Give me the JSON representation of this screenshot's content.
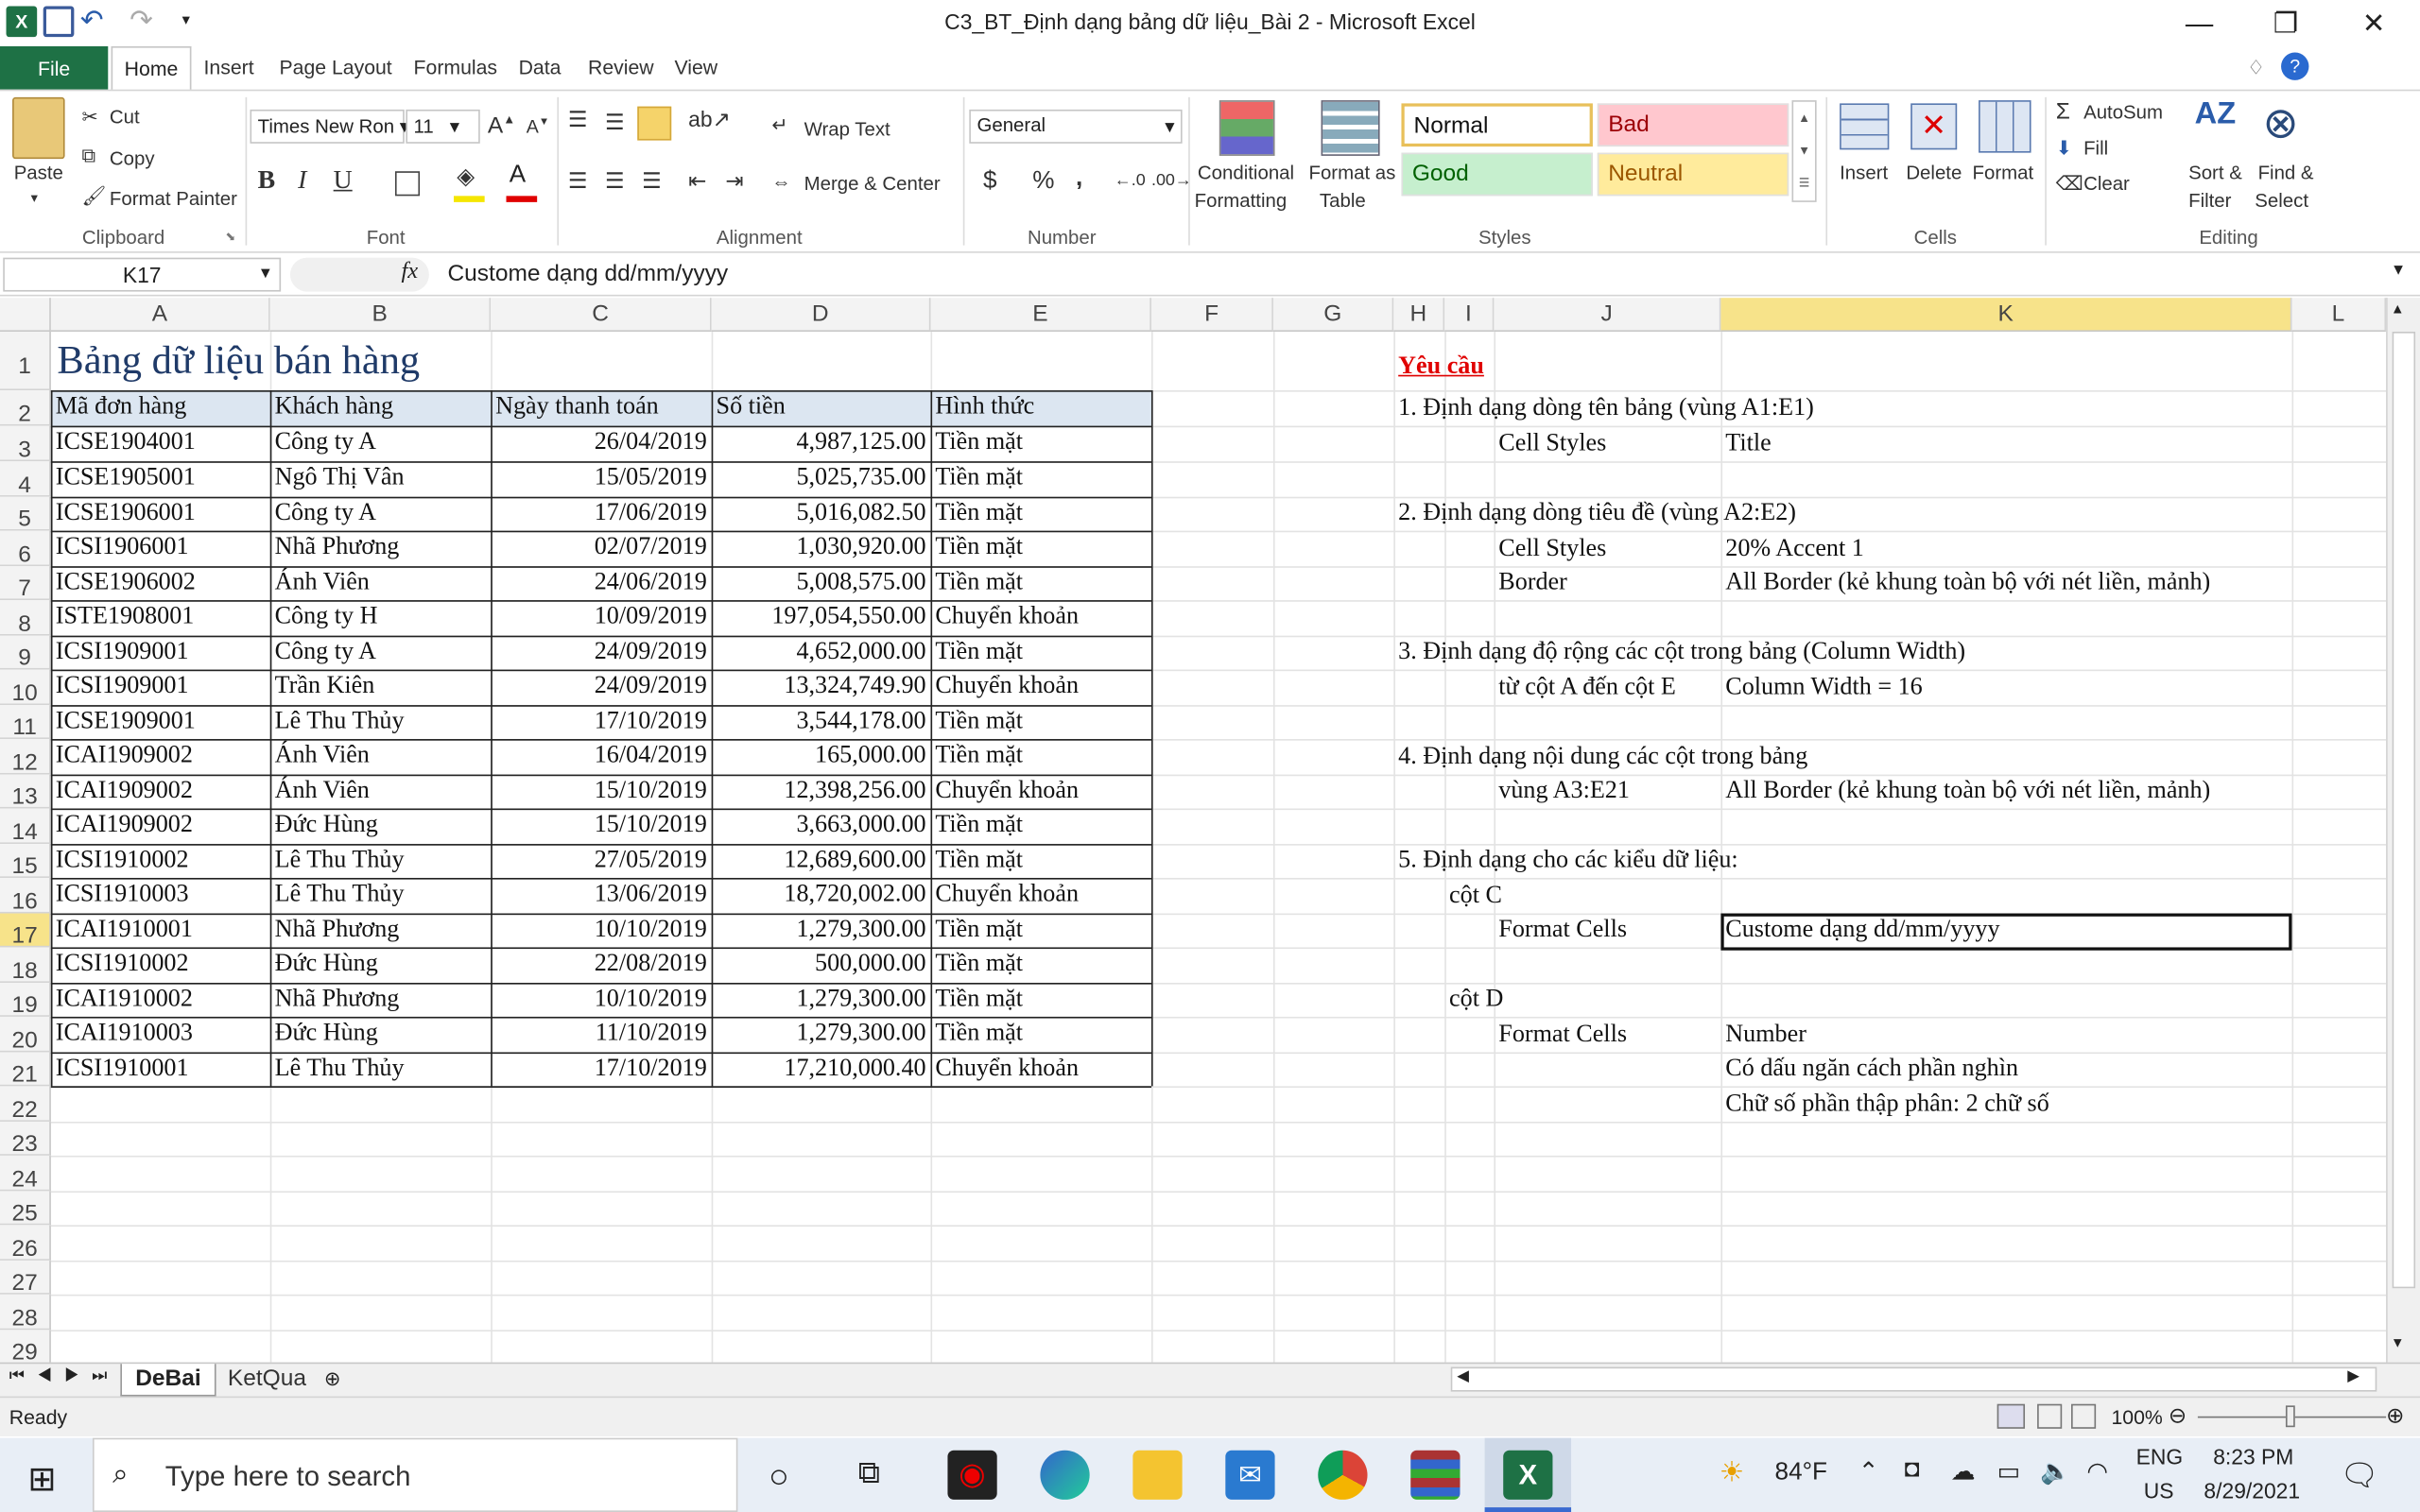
{
  "window": {
    "title": "C3_BT_Định dạng bảng dữ liệu_Bài 2  -  Microsoft Excel",
    "minimize": "—",
    "restore": "❐",
    "close": "✕"
  },
  "tabs": [
    "File",
    "Home",
    "Insert",
    "Page Layout",
    "Formulas",
    "Data",
    "Review",
    "View"
  ],
  "ribbon": {
    "clipboard": {
      "paste": "Paste",
      "cut": "Cut",
      "copy": "Copy",
      "format_painter": "Format Painter",
      "label": "Clipboard"
    },
    "font": {
      "name": "Times New Ron",
      "size": "11",
      "bold": "B",
      "italic": "I",
      "underline": "U",
      "label": "Font"
    },
    "alignment": {
      "wrap": "Wrap Text",
      "merge": "Merge & Center",
      "label": "Alignment"
    },
    "number": {
      "format": "General",
      "currency": "$",
      "percent": "%",
      "comma": ",",
      "label": "Number"
    },
    "styles": {
      "conditional": "Conditional",
      "conditional2": "Formatting",
      "format_table": "Format as",
      "format_table2": "Table",
      "normal": "Normal",
      "bad": "Bad",
      "good": "Good",
      "neutral": "Neutral",
      "label": "Styles"
    },
    "cells": {
      "insert": "Insert",
      "delete": "Delete",
      "format": "Format",
      "label": "Cells"
    },
    "editing": {
      "autosum": "AutoSum",
      "fill": "Fill",
      "clear": "Clear",
      "sort": "Sort &",
      "sort2": "Filter",
      "find": "Find &",
      "find2": "Select",
      "label": "Editing"
    }
  },
  "formula_bar": {
    "name_box": "K17",
    "fx": "fx",
    "content": "Custome dạng dd/mm/yyyy"
  },
  "columns": [
    "A",
    "B",
    "C",
    "D",
    "E",
    "F",
    "G",
    "H",
    "I",
    "J",
    "K",
    "L"
  ],
  "rows": [
    "1",
    "2",
    "3",
    "4",
    "5",
    "6",
    "7",
    "8",
    "9",
    "10",
    "11",
    "12",
    "13",
    "14",
    "15",
    "16",
    "17",
    "18",
    "19",
    "20",
    "21",
    "22",
    "23",
    "24",
    "25",
    "26",
    "27",
    "28",
    "29"
  ],
  "sheet_title": "Bảng dữ liệu bán hàng",
  "table_headers": [
    "Mã đơn hàng",
    "Khách hàng",
    "Ngày thanh toán",
    "Số tiền",
    "Hình thức"
  ],
  "table_rows": [
    [
      "ICSE1904001",
      "Công ty A",
      "26/04/2019",
      "4,987,125.00",
      "Tiền mặt"
    ],
    [
      "ICSE1905001",
      "Ngô Thị Vân",
      "15/05/2019",
      "5,025,735.00",
      "Tiền mặt"
    ],
    [
      "ICSE1906001",
      "Công ty A",
      "17/06/2019",
      "5,016,082.50",
      "Tiền mặt"
    ],
    [
      "ICSI1906001",
      "Nhã Phương",
      "02/07/2019",
      "1,030,920.00",
      "Tiền mặt"
    ],
    [
      "ICSE1906002",
      "Ánh Viên",
      "24/06/2019",
      "5,008,575.00",
      "Tiền mặt"
    ],
    [
      "ISTE1908001",
      "Công ty H",
      "10/09/2019",
      "197,054,550.00",
      "Chuyển khoản"
    ],
    [
      "ICSI1909001",
      "Công ty A",
      "24/09/2019",
      "4,652,000.00",
      "Tiền mặt"
    ],
    [
      "ICSI1909001",
      "Trần Kiên",
      "24/09/2019",
      "13,324,749.90",
      "Chuyển khoản"
    ],
    [
      "ICSE1909001",
      "Lê Thu Thủy",
      "17/10/2019",
      "3,544,178.00",
      "Tiền mặt"
    ],
    [
      "ICAI1909002",
      "Ánh Viên",
      "16/04/2019",
      "165,000.00",
      "Tiền mặt"
    ],
    [
      "ICAI1909002",
      "Ánh Viên",
      "15/10/2019",
      "12,398,256.00",
      "Chuyển khoản"
    ],
    [
      "ICAI1909002",
      "Đức Hùng",
      "15/10/2019",
      "3,663,000.00",
      "Tiền mặt"
    ],
    [
      "ICSI1910002",
      "Lê Thu Thủy",
      "27/05/2019",
      "12,689,600.00",
      "Tiền mặt"
    ],
    [
      "ICSI1910003",
      "Lê Thu Thủy",
      "13/06/2019",
      "18,720,002.00",
      "Chuyển khoản"
    ],
    [
      "ICAI1910001",
      "Nhã Phương",
      "10/10/2019",
      "1,279,300.00",
      "Tiền mặt"
    ],
    [
      "ICSI1910002",
      "Đức Hùng",
      "22/08/2019",
      "500,000.00",
      "Tiền mặt"
    ],
    [
      "ICAI1910002",
      "Nhã Phương",
      "10/10/2019",
      "1,279,300.00",
      "Tiền mặt"
    ],
    [
      "ICAI1910003",
      "Đức Hùng",
      "11/10/2019",
      "1,279,300.00",
      "Tiền mặt"
    ],
    [
      "ICSI1910001",
      "Lê Thu Thủy",
      "17/10/2019",
      "17,210,000.40",
      "Chuyển khoản"
    ]
  ],
  "requirements": {
    "heading": "Yêu cầu",
    "r1": "1. Định dạng dòng tên bảng (vùng A1:E1)",
    "r1_a": "Cell Styles",
    "r1_b": "Title",
    "r2": "2. Định dạng dòng tiêu đề (vùng A2:E2)",
    "r2_a": "Cell Styles",
    "r2_b": "20% Accent 1",
    "r2_c": "Border",
    "r2_d": "All Border (kẻ khung toàn bộ với nét liền, mảnh)",
    "r3": "3. Định dạng độ rộng các cột trong bảng (Column Width)",
    "r3_a": "từ cột A đến cột E",
    "r3_b": "Column Width = 16",
    "r4": "4. Định dạng nội dung các cột trong bảng",
    "r4_a": "vùng A3:E21",
    "r4_b": "All Border (kẻ khung toàn bộ với nét liền, mảnh)",
    "r5": "5. Định dạng cho các kiểu dữ liệu:",
    "r5_c": "cột C",
    "r5_c_a": "Format Cells",
    "r5_c_b": "Custome dạng dd/mm/yyyy",
    "r5_d": "cột D",
    "r5_d_a": "Format Cells",
    "r5_d_b": "Number",
    "r5_d_c": "Có dấu ngăn cách phần nghìn",
    "r5_d_d": "Chữ số phần thập phân: 2 chữ số"
  },
  "sheets": [
    "DeBai",
    "KetQua"
  ],
  "status": {
    "ready": "Ready",
    "zoom": "100%"
  },
  "taskbar": {
    "search": "Type here to search",
    "weather": "84°F",
    "lang1": "ENG",
    "lang2": "US",
    "time": "8:23 PM",
    "date": "8/29/2021"
  },
  "colors": {
    "excel_green": "#1e7145",
    "selected_col": "#f7e38a",
    "header_fill": "#dce6f1",
    "red_heading": "#e00000"
  }
}
